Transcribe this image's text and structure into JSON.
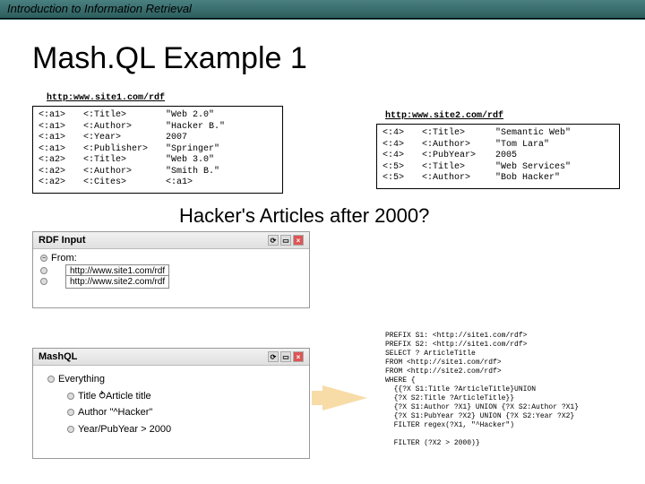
{
  "header": {
    "course": "Introduction to Information Retrieval"
  },
  "title": "Mash.QL Example 1",
  "rdf1": {
    "label": "http:www.site1.com/rdf",
    "rows": [
      {
        "s": "<:a1>",
        "p": "<:Title>",
        "o": "\"Web 2.0\""
      },
      {
        "s": "<:a1>",
        "p": "<:Author>",
        "o": "\"Hacker B.\""
      },
      {
        "s": "<:a1>",
        "p": "<:Year>",
        "o": "2007"
      },
      {
        "s": "<:a1>",
        "p": "<:Publisher>",
        "o": "\"Springer\""
      },
      {
        "s": "<:a2>",
        "p": "<:Title>",
        "o": "\"Web 3.0\""
      },
      {
        "s": "<:a2>",
        "p": "<:Author>",
        "o": "\"Smith B.\""
      },
      {
        "s": "<:a2>",
        "p": "<:Cites>",
        "o": "<:a1>"
      }
    ]
  },
  "rdf2": {
    "label": "http:www.site2.com/rdf",
    "rows": [
      {
        "s": "<:4>",
        "p": "<:Title>",
        "o": "\"Semantic Web\""
      },
      {
        "s": "<:4>",
        "p": "<:Author>",
        "o": "\"Tom Lara\""
      },
      {
        "s": "<:4>",
        "p": "<:PubYear>",
        "o": "2005"
      },
      {
        "s": "<:5>",
        "p": "<:Title>",
        "o": "\"Web Services\""
      },
      {
        "s": "<:5>",
        "p": "<:Author>",
        "o": "\"Bob Hacker\""
      }
    ]
  },
  "question": "Hacker's Articles after 2000?",
  "rdfInput": {
    "title": "RDF Input",
    "fromLabel": "From:",
    "urls": [
      "http://www.site1.com/rdf",
      "http://www.site2.com/rdf"
    ]
  },
  "mashql": {
    "title": "MashQL",
    "root": "Everything",
    "items": [
      "Title   ⥁Article title",
      "Author \"^Hacker\"",
      "Year/PubYear > 2000"
    ]
  },
  "sparql": "PREFIX S1: <http://site1.com/rdf>\nPREFIX S2: <http://site1.com/rdf>\nSELECT ? ArticleTitle\nFROM <http://site1.com/rdf>\nFROM <http://site2.com/rdf>\nWHERE {\n  {{?X S1:Title ?ArticleTitle}UNION\n  {?X S2:Title ?ArticleTitle}}\n  {?X S1:Author ?X1} UNION {?X S2:Author ?X1}\n  {?X S1:PubYear ?X2} UNION {?X S2:Year ?X2}\n  FILTER regex(?X1, \"^Hacker\")\n\n  FILTER (?X2 > 2000)}"
}
